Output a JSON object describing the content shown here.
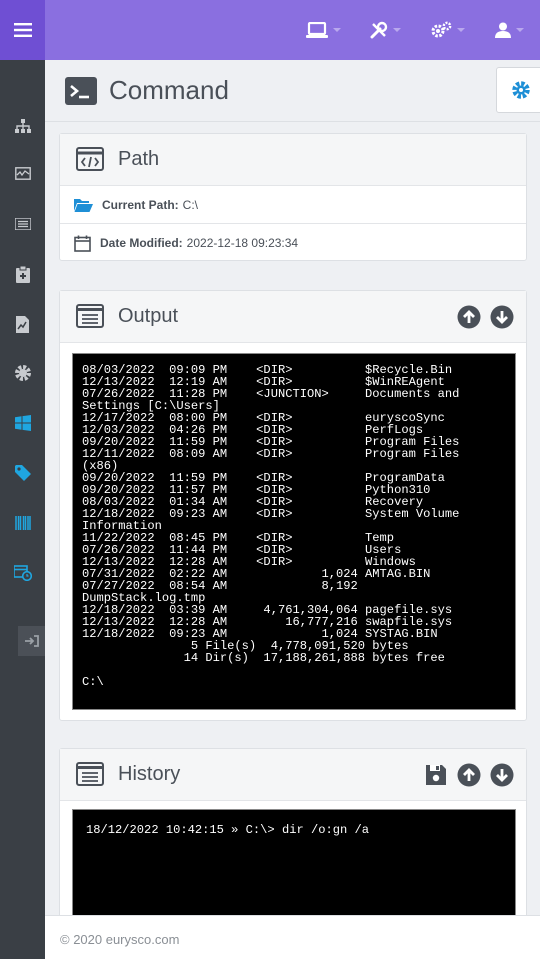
{
  "page": {
    "title": "Command"
  },
  "path_card": {
    "title": "Path",
    "current_path_label": "Current Path:",
    "current_path_value": "C:\\",
    "date_modified_label": "Date Modified:",
    "date_modified_value": "2022-12-18 09:23:34"
  },
  "output_card": {
    "title": "Output",
    "terminal_text": "08/03/2022  09:09 PM    <DIR>          $Recycle.Bin\n12/13/2022  12:19 AM    <DIR>          $WinREAgent\n07/26/2022  11:28 PM    <JUNCTION>     Documents and\nSettings [C:\\Users]\n12/17/2022  08:00 PM    <DIR>          euryscoSync\n12/03/2022  04:26 PM    <DIR>          PerfLogs\n09/20/2022  11:59 PM    <DIR>          Program Files\n12/11/2022  08:09 AM    <DIR>          Program Files\n(x86)\n09/20/2022  11:59 PM    <DIR>          ProgramData\n09/20/2022  11:57 PM    <DIR>          Python310\n08/03/2022  01:34 AM    <DIR>          Recovery\n12/18/2022  09:23 AM    <DIR>          System Volume\nInformation\n11/22/2022  08:45 PM    <DIR>          Temp\n07/26/2022  11:44 PM    <DIR>          Users\n12/13/2022  12:28 AM    <DIR>          Windows\n07/31/2022  02:22 AM             1,024 AMTAG.BIN\n07/27/2022  08:54 AM             8,192\nDumpStack.log.tmp\n12/18/2022  03:39 AM     4,761,304,064 pagefile.sys\n12/13/2022  12:28 AM        16,777,216 swapfile.sys\n12/18/2022  09:23 AM             1,024 SYSTAG.BIN\n               5 File(s)  4,778,091,520 bytes\n              14 Dir(s)  17,188,261,888 bytes free\n\nC:\\"
  },
  "history_card": {
    "title": "History",
    "entry": "18/12/2022 10:42:15 » C:\\> dir /o:gn /a"
  },
  "footer": {
    "text": "© 2020   eurysco.com"
  }
}
